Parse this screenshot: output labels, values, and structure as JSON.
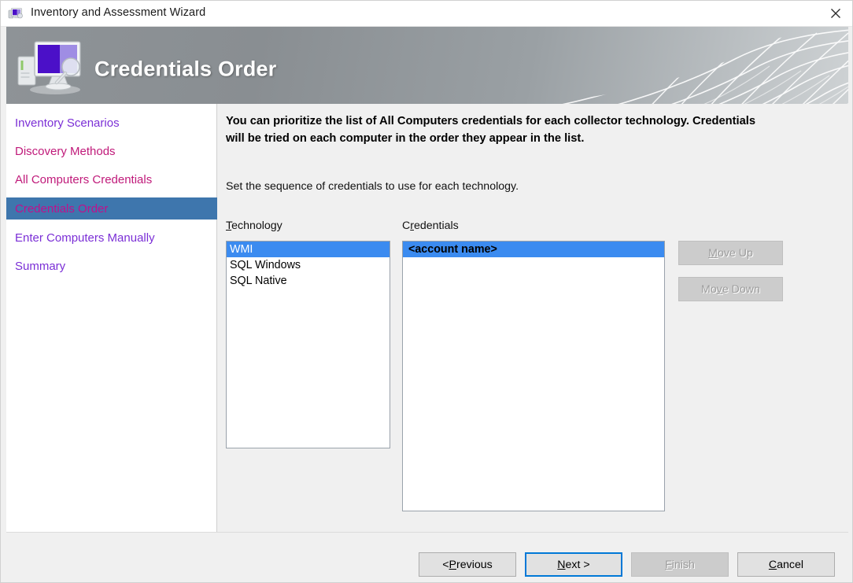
{
  "window": {
    "title": "Inventory and Assessment Wizard",
    "icon": "computer-monitor-icon",
    "close_label": "✕"
  },
  "banner": {
    "title": "Credentials Order",
    "icon": "computer-inventory-icon"
  },
  "sidebar": {
    "items": [
      {
        "label": "Inventory Scenarios",
        "color": "#7b2fd6",
        "selected": false
      },
      {
        "label": "Discovery Methods",
        "color": "#c01a7a",
        "selected": false
      },
      {
        "label": "All Computers Credentials",
        "color": "#c01a7a",
        "selected": false
      },
      {
        "label": "Credentials Order",
        "color": "#c0108c",
        "selected": true
      },
      {
        "label": "Enter Computers Manually",
        "color": "#7b2fd6",
        "selected": false
      },
      {
        "label": "Summary",
        "color": "#7b2fd6",
        "selected": false
      }
    ],
    "selected_bg": "#3e76ad"
  },
  "content": {
    "intro_bold": "You can prioritize the list of All Computers credentials for each collector technology. Credentials will be tried on each computer in the order they appear in the list.",
    "intro_sub": "Set the sequence of credentials to use for each technology.",
    "technology": {
      "label_accel": "T",
      "label_rest": "echnology",
      "items": [
        {
          "label": "WMI",
          "selected": true
        },
        {
          "label": "SQL Windows",
          "selected": false
        },
        {
          "label": "SQL Native",
          "selected": false
        }
      ]
    },
    "credentials": {
      "label_pre": "C",
      "label_accel": "r",
      "label_rest": "edentials",
      "items": [
        {
          "label": "<account name>",
          "selected": true
        }
      ]
    },
    "move_up": {
      "pre": "",
      "accel": "M",
      "rest": "ove Up",
      "disabled": true
    },
    "move_down": {
      "pre": "Mo",
      "accel": "v",
      "rest": "e Down",
      "disabled": true
    }
  },
  "footer": {
    "previous": {
      "pre": "< ",
      "accel": "P",
      "rest": "revious",
      "disabled": false,
      "default": false
    },
    "next": {
      "pre": "",
      "accel": "N",
      "rest": "ext >",
      "disabled": false,
      "default": true
    },
    "finish": {
      "pre": "",
      "accel": "F",
      "rest": "inish",
      "disabled": true,
      "default": false
    },
    "cancel": {
      "pre": "",
      "accel": "C",
      "rest": "ancel",
      "disabled": false,
      "default": false
    }
  },
  "colors": {
    "accent_blue": "#0078d7",
    "selection_blue": "#3b8bf0",
    "sidebar_selected": "#3e76ad",
    "banner_gray": "#9aa0a4",
    "face": "#f0f0f0"
  }
}
